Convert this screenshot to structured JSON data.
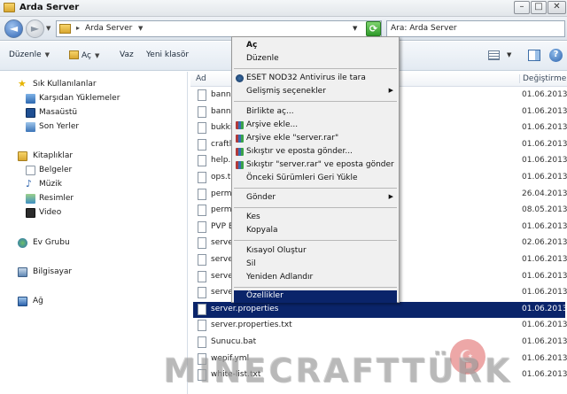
{
  "window": {
    "title": "Arda Server"
  },
  "address": {
    "crumb": "Arda Server",
    "search_placeholder": "Ara: Arda Server"
  },
  "toolbar": {
    "organize": "Düzenle",
    "open": "Aç",
    "burn": "Vaz",
    "new_folder": "Yeni klasör"
  },
  "nav": {
    "favorites_header": "Sık Kullanılanlar",
    "favorites": [
      "Karşıdan Yüklemeler",
      "Masaüstü",
      "Son Yerler"
    ],
    "libraries_header": "Kitaplıklar",
    "libraries": [
      "Belgeler",
      "Müzik",
      "Resimler",
      "Video"
    ],
    "homegroup": "Ev Grubu",
    "computer": "Bilgisayar",
    "network": "Ağ"
  },
  "columns": {
    "name": "Ad",
    "date": "Değiştirme"
  },
  "files": [
    {
      "name": "bann",
      "date": "01.06.2013"
    },
    {
      "name": "bann",
      "date": "01.06.2013"
    },
    {
      "name": "bukki",
      "date": "01.06.2013"
    },
    {
      "name": "craftl",
      "date": "01.06.2013"
    },
    {
      "name": "help.",
      "date": "01.06.2013"
    },
    {
      "name": "ops.t",
      "date": "01.06.2013"
    },
    {
      "name": "perm",
      "date": "26.04.2013"
    },
    {
      "name": "perm",
      "date": "08.05.2013"
    },
    {
      "name": "PVP E",
      "date": "01.06.2013"
    },
    {
      "name": "serve",
      "date": "02.06.2013"
    },
    {
      "name": "serve",
      "date": "01.06.2013"
    },
    {
      "name": "serve",
      "date": "01.06.2013"
    },
    {
      "name": "serve",
      "date": "01.06.2013"
    },
    {
      "name": "server.properties",
      "date": "01.06.2013",
      "selected": true
    },
    {
      "name": "server.properties.txt",
      "date": "01.06.2013"
    },
    {
      "name": "Sunucu.bat",
      "date": "01.06.2013"
    },
    {
      "name": "wepif.yml",
      "date": "01.06.2013"
    },
    {
      "name": "white-list.txt",
      "date": "01.06.2013"
    }
  ],
  "context_menu": {
    "open": "Aç",
    "edit": "Düzenle",
    "eset_scan": "ESET NOD32 Antivirus ile tara",
    "advanced": "Gelişmiş seçenekler",
    "open_with": "Birlikte aç...",
    "add_archive": "Arşive ekle...",
    "add_server_rar": "Arşive ekle \"server.rar\"",
    "compress_email": "Sıkıştır ve eposta gönder...",
    "compress_server_email": "Sıkıştır \"server.rar\" ve eposta gönder",
    "restore": "Önceki Sürümleri Geri Yükle",
    "send_to": "Gönder",
    "cut": "Kes",
    "copy": "Kopyala",
    "create_shortcut": "Kısayol Oluştur",
    "delete": "Sil",
    "rename": "Yeniden Adlandır",
    "properties": "Özellikler"
  },
  "watermark": {
    "text": "MINECRAFTTÜRK"
  },
  "colors": {
    "selection": "#0a246a",
    "menu_bg": "#f0f0f0",
    "toolbar_bg": "#e3eaf2"
  }
}
